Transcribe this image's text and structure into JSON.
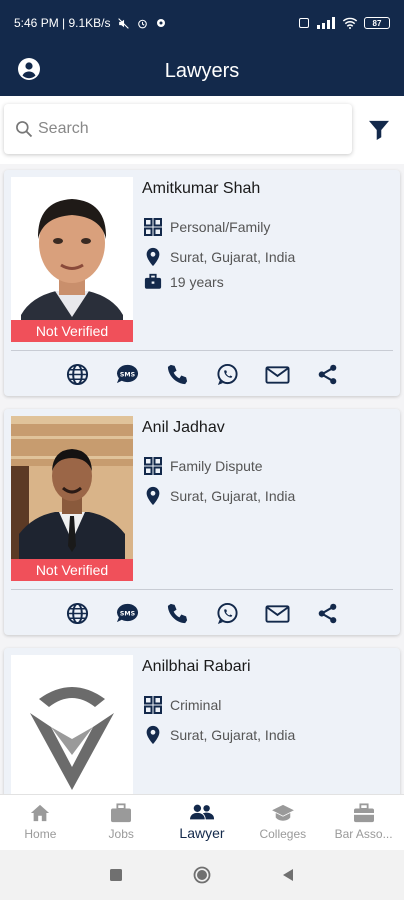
{
  "status": {
    "time_info": "5:46 PM | 9.1KB/s",
    "battery": "87"
  },
  "appbar": {
    "title": "Lawyers"
  },
  "search": {
    "placeholder": "Search"
  },
  "lawyers": [
    {
      "name": "Amitkumar Shah",
      "category": "Personal/Family",
      "location": "Surat, Gujarat, India",
      "experience": "19 years",
      "badge": "Not Verified"
    },
    {
      "name": "Anil Jadhav",
      "category": "Family Dispute",
      "location": "Surat, Gujarat, India",
      "badge": "Not Verified"
    },
    {
      "name": "Anilbhai Rabari",
      "category": "Criminal",
      "location": "Surat, Gujarat, India"
    }
  ],
  "bottom_nav": [
    {
      "label": "Home",
      "icon": "home-icon",
      "active": false
    },
    {
      "label": "Jobs",
      "icon": "briefcase-icon",
      "active": false
    },
    {
      "label": "Lawyer",
      "icon": "people-icon",
      "active": true
    },
    {
      "label": "Colleges",
      "icon": "graduation-cap-icon",
      "active": false
    },
    {
      "label": "Bar Asso...",
      "icon": "briefcase-icon",
      "active": false
    }
  ],
  "colors": {
    "primary": "#13294b",
    "card_bg": "#eef2f8",
    "badge_red": "#f0505a",
    "inactive": "#9a9a9a"
  }
}
